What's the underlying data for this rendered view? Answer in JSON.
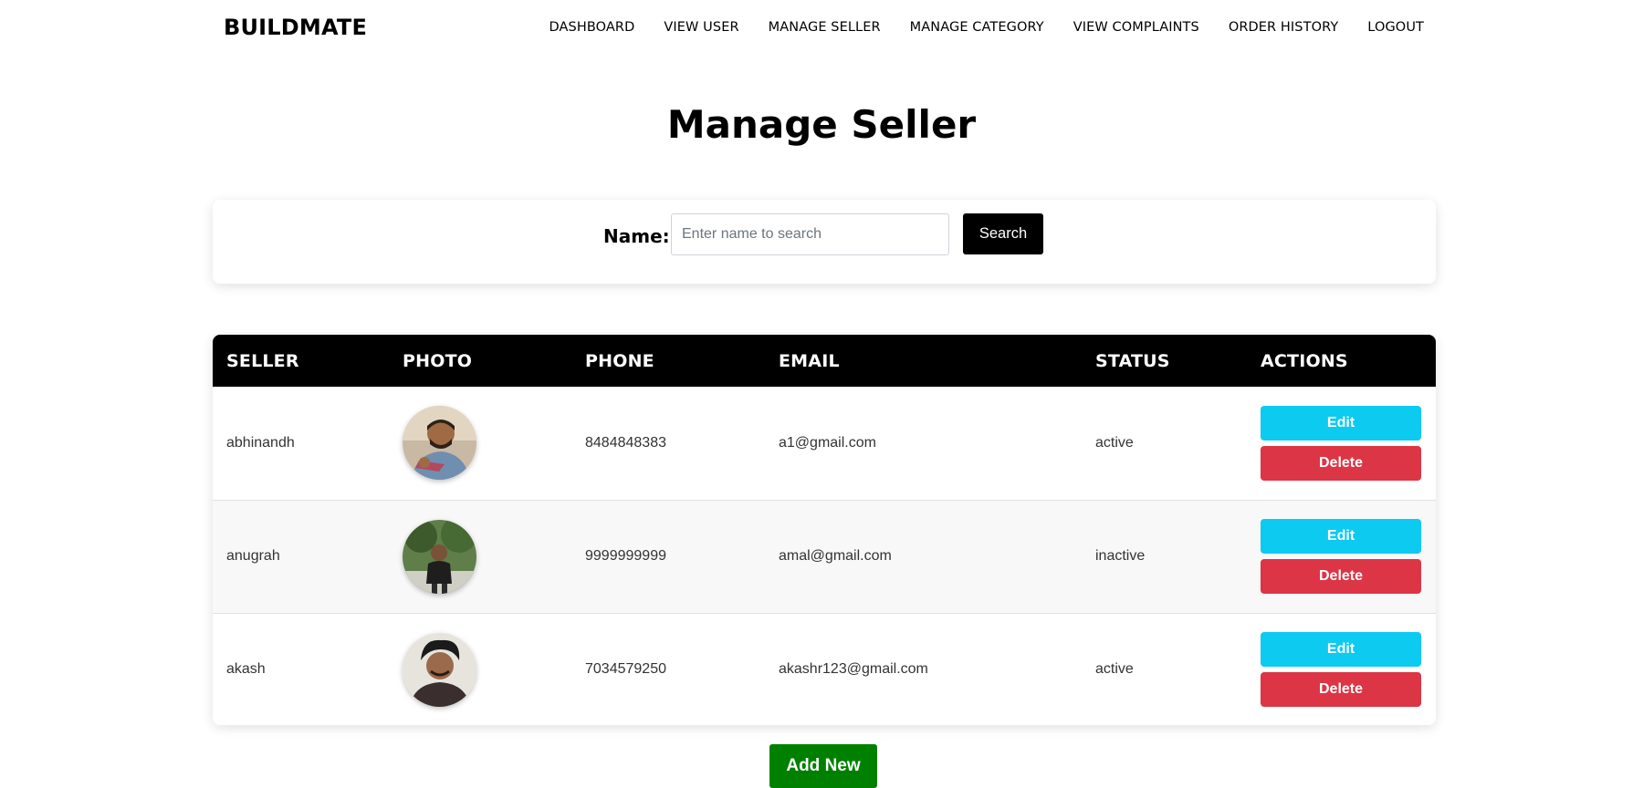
{
  "nav": {
    "brand": "BUILDMATE",
    "links": [
      "DASHBOARD",
      "VIEW USER",
      "MANAGE SELLER",
      "MANAGE CATEGORY",
      "VIEW COMPLAINTS",
      "ORDER HISTORY",
      "LOGOUT"
    ]
  },
  "page_title": "Manage Seller",
  "search": {
    "label": "Name:",
    "placeholder": "Enter name to search",
    "value": "",
    "button_label": "Search"
  },
  "table": {
    "headers": [
      "SELLER",
      "PHOTO",
      "PHONE",
      "EMAIL",
      "STATUS",
      "ACTIONS"
    ],
    "rows": [
      {
        "seller": "abhinandh",
        "phone": "8484848383",
        "email": "a1@gmail.com",
        "status": "active",
        "photo_icon": "seller-photo-icon"
      },
      {
        "seller": "anugrah",
        "phone": "9999999999",
        "email": "amal@gmail.com",
        "status": "inactive",
        "photo_icon": "seller-photo-icon"
      },
      {
        "seller": "akash",
        "phone": "7034579250",
        "email": "akashr123@gmail.com",
        "status": "active",
        "photo_icon": "seller-photo-icon"
      }
    ],
    "edit_label": "Edit",
    "delete_label": "Delete"
  },
  "add_new_label": "Add New",
  "colors": {
    "header_bg": "#000000",
    "edit": "#0dcaf0",
    "delete": "#dc3545",
    "add_new": "#008000"
  }
}
